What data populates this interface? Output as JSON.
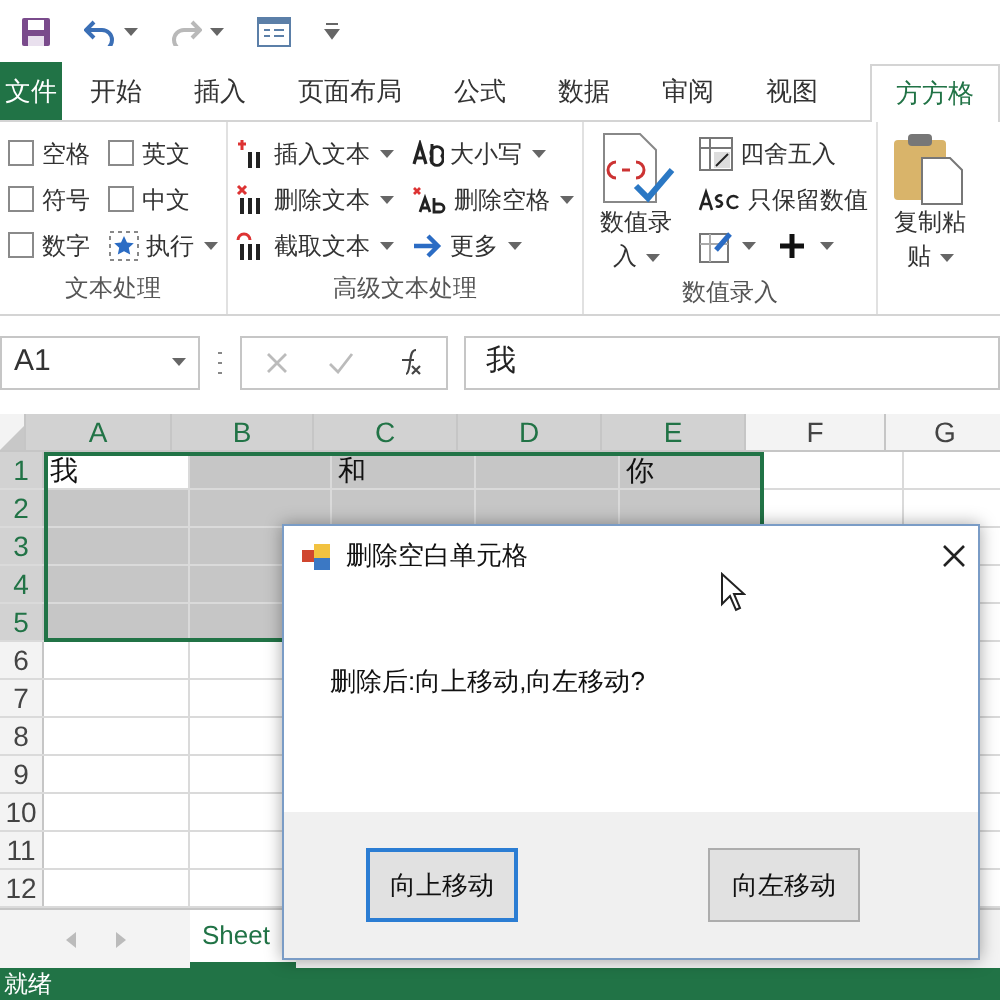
{
  "quick_access": [
    {
      "kind": "save",
      "disabled": false
    },
    {
      "kind": "undo",
      "disabled": false
    },
    {
      "kind": "redo",
      "disabled": true
    },
    {
      "kind": "form",
      "disabled": false
    },
    {
      "kind": "customize",
      "disabled": false
    }
  ],
  "file_tab": "文件",
  "tabs": [
    {
      "label": "开始",
      "selected": false
    },
    {
      "label": "插入",
      "selected": false
    },
    {
      "label": "页面布局",
      "selected": false
    },
    {
      "label": "公式",
      "selected": false
    },
    {
      "label": "数据",
      "selected": false
    },
    {
      "label": "审阅",
      "selected": false
    },
    {
      "label": "视图",
      "selected": false
    },
    {
      "label": "方方格",
      "selected": true
    }
  ],
  "ribbon_groups": [
    {
      "title": "文本处理",
      "columns": [
        [
          {
            "kind": "checkbox",
            "label": "空格",
            "checked": false
          },
          {
            "kind": "checkbox",
            "label": "符号",
            "checked": false
          },
          {
            "kind": "checkbox",
            "label": "数字",
            "checked": false
          }
        ],
        [
          {
            "kind": "checkbox",
            "label": "英文",
            "checked": false
          },
          {
            "kind": "checkbox",
            "label": "中文",
            "checked": false
          },
          {
            "kind": "button",
            "label": "执行",
            "dropdown": true
          }
        ]
      ]
    },
    {
      "title": "高级文本处理",
      "columns": [
        [
          {
            "kind": "button",
            "label": "插入文本",
            "dropdown": true
          },
          {
            "kind": "button",
            "label": "删除文本",
            "dropdown": true
          },
          {
            "kind": "button",
            "label": "截取文本",
            "dropdown": true
          }
        ],
        [
          {
            "kind": "button",
            "label": "大小写",
            "dropdown": true
          },
          {
            "kind": "button",
            "label": "删除空格",
            "dropdown": true
          },
          {
            "kind": "button",
            "label": "更多",
            "dropdown": true
          }
        ]
      ]
    },
    {
      "title": "数值录入",
      "columns": [
        [
          {
            "kind": "large",
            "label": "数值录入",
            "dropdown": true
          }
        ],
        [
          {
            "kind": "button",
            "label": "四舍五入",
            "dropdown": false
          },
          {
            "kind": "button",
            "label": "只保留数值",
            "dropdown": false
          },
          {
            "kind": "icons",
            "dropdown": true
          }
        ]
      ]
    },
    {
      "columns": [
        [
          {
            "kind": "large",
            "label": "复制粘贴",
            "dropdown": true
          }
        ]
      ]
    }
  ],
  "formula_bar": {
    "name_box": "A1",
    "value": "我"
  },
  "sheet": {
    "columns": [
      {
        "label": "A",
        "selected": true
      },
      {
        "label": "B",
        "selected": true
      },
      {
        "label": "C",
        "selected": true
      },
      {
        "label": "D",
        "selected": true
      },
      {
        "label": "E",
        "selected": true
      },
      {
        "label": "F",
        "selected": false
      },
      {
        "label": "G",
        "selected": false
      }
    ],
    "rows": [
      {
        "label": "1",
        "selected": true,
        "cells": {
          "A": "我",
          "C": "和",
          "E": "你"
        }
      },
      {
        "label": "2",
        "selected": true
      },
      {
        "label": "3",
        "selected": true
      },
      {
        "label": "4",
        "selected": true
      },
      {
        "label": "5",
        "selected": true
      },
      {
        "label": "6",
        "selected": false
      },
      {
        "label": "7",
        "selected": false
      },
      {
        "label": "8",
        "selected": false
      },
      {
        "label": "9",
        "selected": false
      },
      {
        "label": "10",
        "selected": false
      },
      {
        "label": "11",
        "selected": false
      },
      {
        "label": "12",
        "selected": false
      }
    ]
  },
  "sheet_tabs": [
    {
      "label": "Sheet",
      "selected": true
    }
  ],
  "status_bar": "就绪",
  "dialog": {
    "title": "删除空白单元格",
    "message": "删除后:向上移动,向左移动?",
    "buttons": [
      {
        "label": "向上移动",
        "focused": true
      },
      {
        "label": "向左移动",
        "focused": false
      }
    ]
  }
}
